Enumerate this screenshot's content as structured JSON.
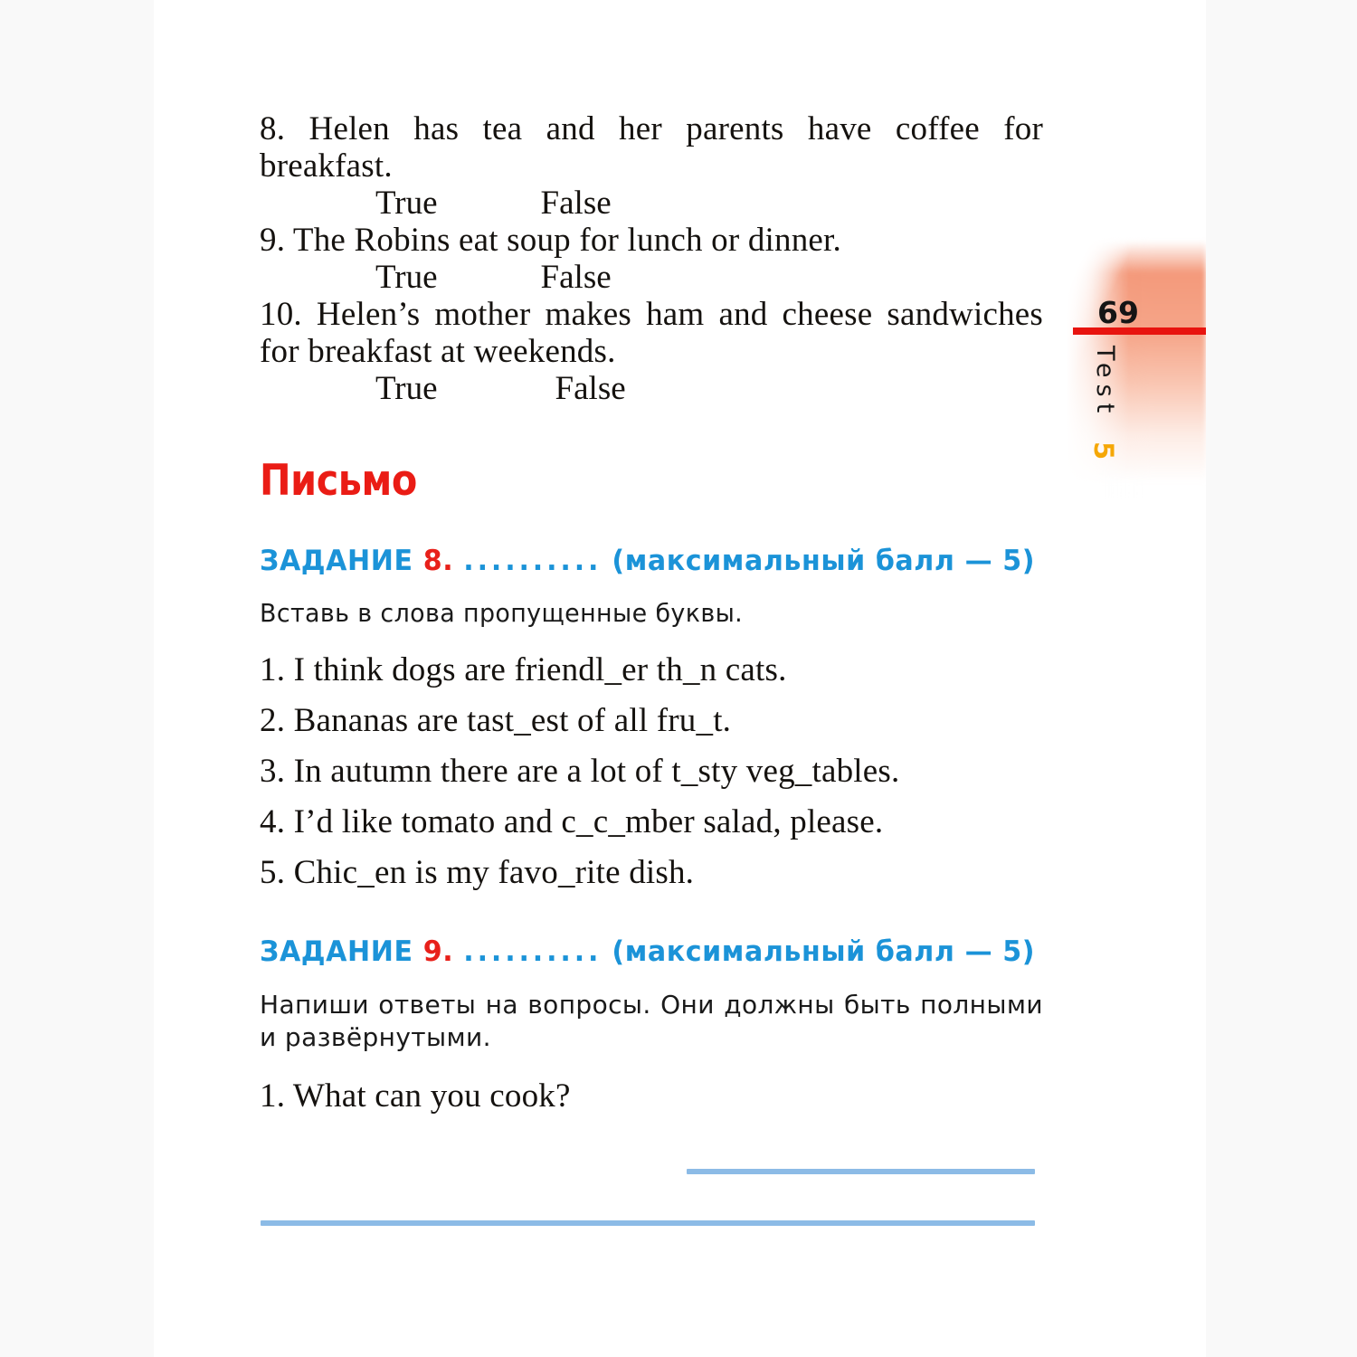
{
  "page": {
    "number": "69",
    "tab_label": "Test",
    "tab_number": "5",
    "accent_red": "#e8140f",
    "accent_blue": "#1b93d8",
    "accent_orange": "#f5a706",
    "rule_blue": "#8cbbe6"
  },
  "reading_tail": {
    "items": [
      {
        "number": "8.",
        "text": "8. Helen has tea and her parents have coffee for breakfast.",
        "true_label": "True",
        "false_label": "False"
      },
      {
        "number": "9.",
        "text": "9. The Robins eat soup for lunch or dinner.",
        "true_label": "True",
        "false_label": "False"
      },
      {
        "number": "10.",
        "text": "10. Helen’s mother makes ham and cheese sandwiches for breakfast at weekends.",
        "true_label": "True",
        "false_label": "False"
      }
    ]
  },
  "section": {
    "title": "Письмо"
  },
  "task8": {
    "label": "ЗАДАНИЕ",
    "number": "8.",
    "dots": "..........",
    "score": "(максимальный балл — 5)",
    "instruction": "Вставь в слова пропущенные буквы.",
    "items": [
      "1. I think dogs are friendl_er th_n cats.",
      "2. Bananas are tast_est of all fru_t.",
      "3. In autumn there are a lot of t_sty veg_tables.",
      "4. I’d like tomato and c_c_mber salad, please.",
      "5. Chic_en is my favo_rite dish."
    ]
  },
  "task9": {
    "label": "ЗАДАНИЕ",
    "number": "9.",
    "dots": "..........",
    "score": "(максимальный балл — 5)",
    "instruction": "Напиши ответы на вопросы. Они должны быть полными и развёрнутыми.",
    "question1": "1. What can you cook?"
  }
}
